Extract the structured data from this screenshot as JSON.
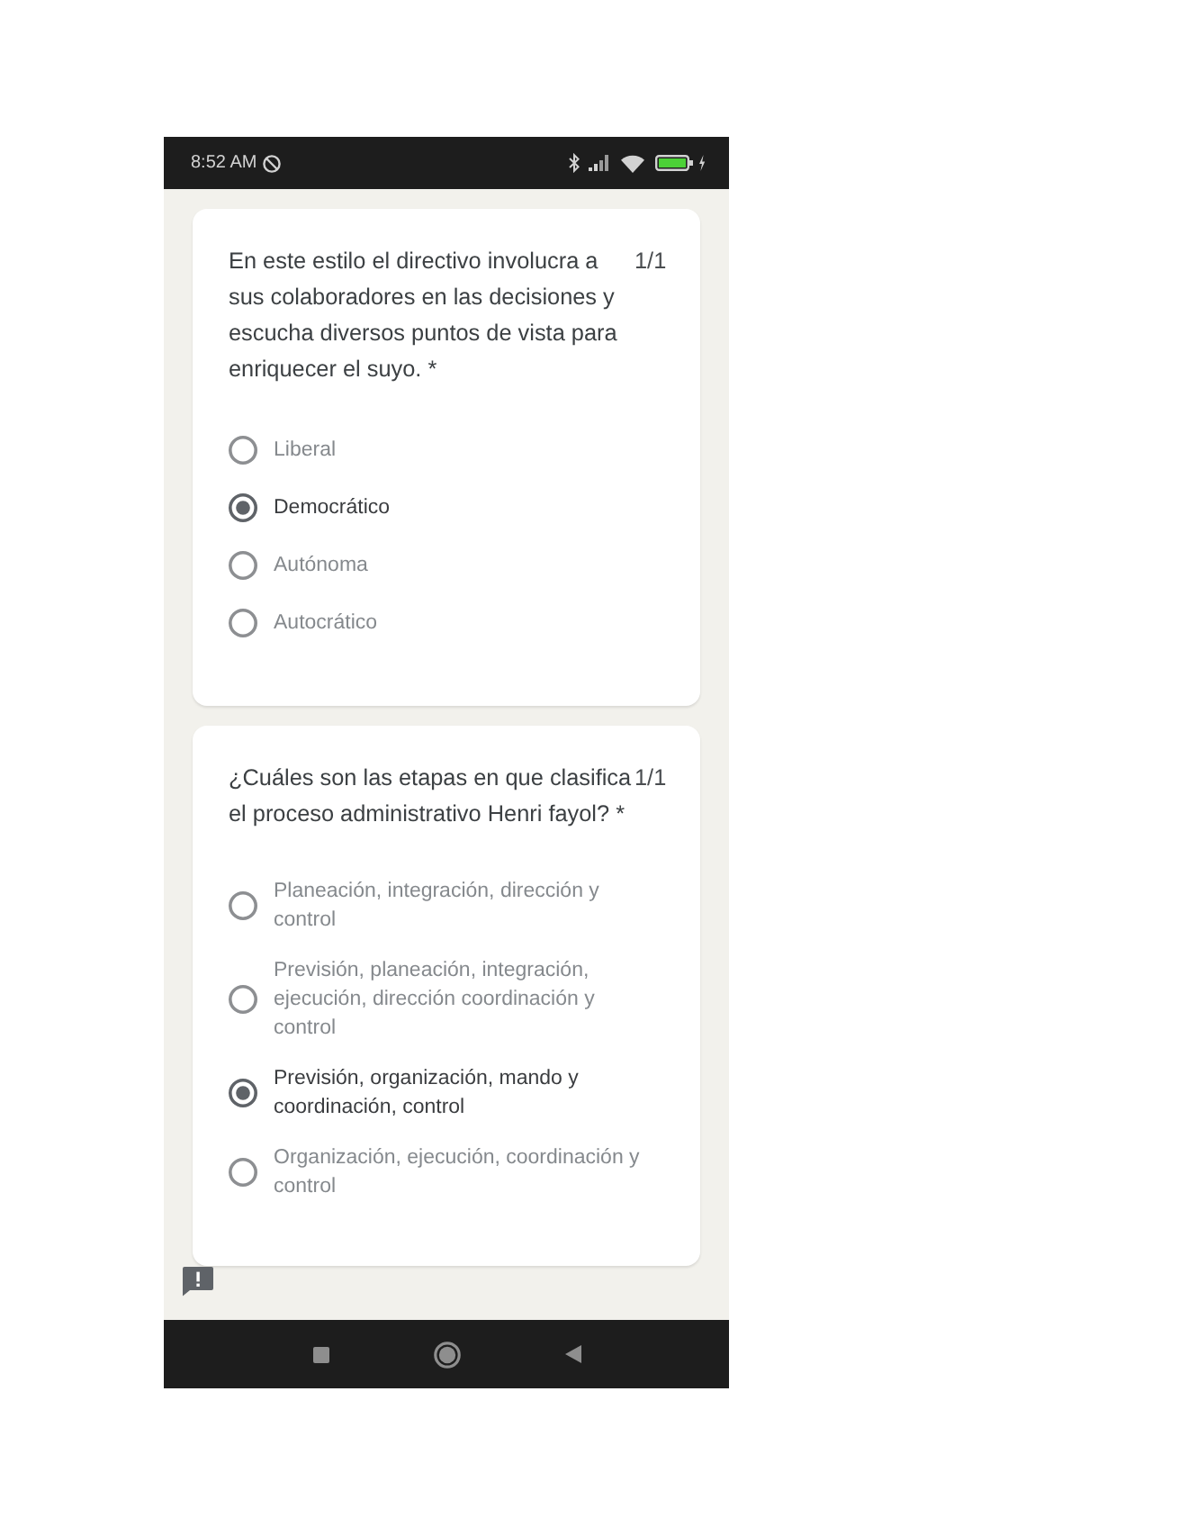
{
  "status_bar": {
    "time": "8:52 AM"
  },
  "questions": [
    {
      "text": "En este estilo el directivo involucra a sus colaboradores en las decisiones y escucha diversos puntos de vista para enriquecer el suyo.",
      "required_mark": "*",
      "score": "1/1",
      "options": [
        {
          "label": "Liberal",
          "selected": false
        },
        {
          "label": "Democrático",
          "selected": true
        },
        {
          "label": "Autónoma",
          "selected": false
        },
        {
          "label": "Autocrático",
          "selected": false
        }
      ]
    },
    {
      "text": "¿Cuáles son las etapas en que clasifica el proceso administrativo Henri fayol?",
      "required_mark": "*",
      "score": "1/1",
      "options": [
        {
          "label": "Planeación, integración, dirección y control",
          "selected": false
        },
        {
          "label": "Previsión, planeación, integración, ejecución, dirección coordinación y control",
          "selected": false
        },
        {
          "label": "Previsión, organización, mando y coordinación, control",
          "selected": true
        },
        {
          "label": "Organización, ejecución, coordinación y control",
          "selected": false
        }
      ]
    }
  ]
}
